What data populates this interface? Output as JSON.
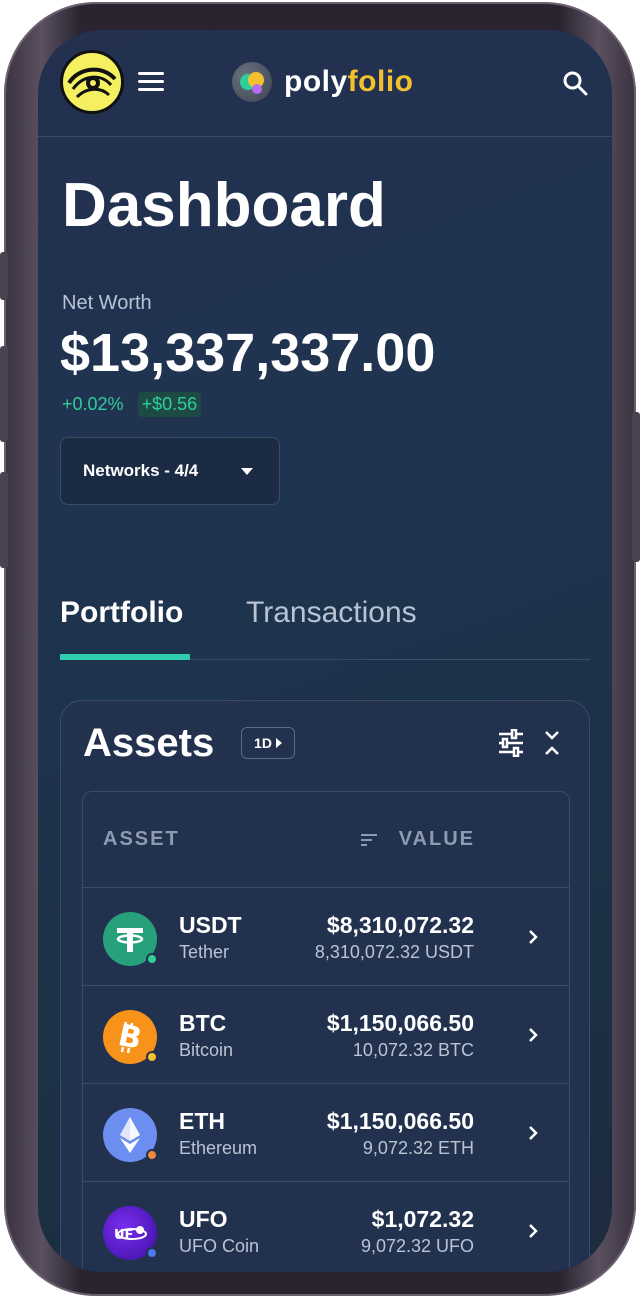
{
  "header": {
    "logo_part1": "poly",
    "logo_part2": "folio",
    "icons": [
      "avatar",
      "menu-icon",
      "search-icon"
    ]
  },
  "dashboard": {
    "title": "Dashboard",
    "net_worth_label": "Net Worth",
    "net_worth_value": "$13,337,337.00",
    "change_percent": "+0.02%",
    "change_usd": "+$0.56",
    "networks_label": "Networks - 4/4"
  },
  "tabs": [
    {
      "label": "Portfolio",
      "active": true
    },
    {
      "label": "Transactions",
      "active": false
    }
  ],
  "assets": {
    "title": "Assets",
    "period": "1D",
    "columns": {
      "asset": "ASSET",
      "value": "VALUE"
    },
    "rows": [
      {
        "symbol": "USDT",
        "name": "Tether",
        "usd": "$8,310,072.32",
        "amount": "8,310,072.32 USDT",
        "color": "#26a17b",
        "badge": "#2ecf9a"
      },
      {
        "symbol": "BTC",
        "name": "Bitcoin",
        "usd": "$1,150,066.50",
        "amount": "10,072.32 BTC",
        "color": "#f7931a",
        "badge": "#f4c12e"
      },
      {
        "symbol": "ETH",
        "name": "Ethereum",
        "usd": "$1,150,066.50",
        "amount": "9,072.32 ETH",
        "color": "#6b8ef0",
        "badge": "#f08a3c"
      },
      {
        "symbol": "UFO",
        "name": "UFO Coin",
        "usd": "$1,072.32",
        "amount": "9,072.32 UFO",
        "color": "#5b1fd0",
        "badge": "#4a7cf0"
      }
    ]
  },
  "colors": {
    "accent": "#2ecfae",
    "positive": "#2ecf9a",
    "brand_yellow": "#f4c12e",
    "background": "#1f3450"
  }
}
